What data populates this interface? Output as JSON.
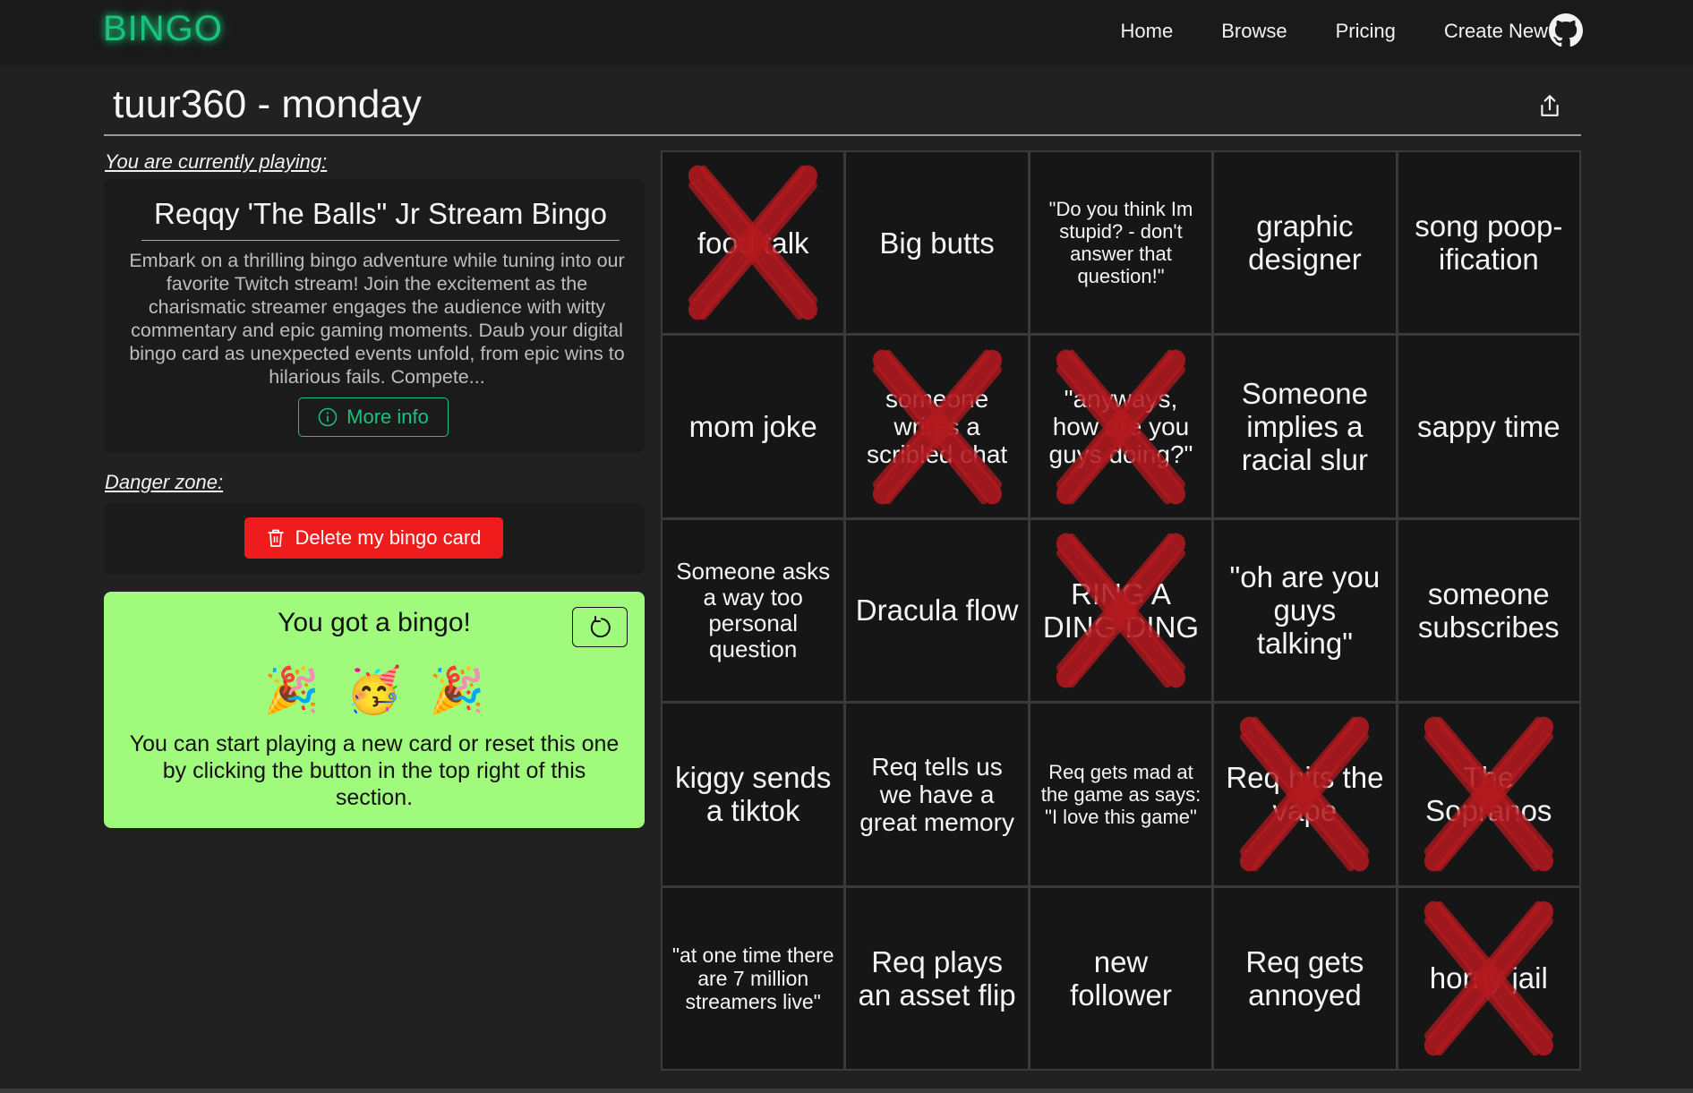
{
  "nav": {
    "logo": "BINGO",
    "links": [
      "Home",
      "Browse",
      "Pricing",
      "Create New"
    ],
    "github_icon": "github-icon"
  },
  "page": {
    "title": "tuur360 - monday",
    "share_icon": "share-icon"
  },
  "playing": {
    "label": "You are currently playing:",
    "game_title": "Reqqy 'The Balls\" Jr Stream Bingo",
    "description": "Embark on a thrilling bingo adventure while tuning into our favorite Twitch stream! Join the excitement as the charismatic streamer engages the audience with witty commentary and epic gaming moments. Daub your digital bingo card as unexpected events unfold, from epic wins to hilarious fails. Compete...",
    "more_info_label": "More info"
  },
  "danger": {
    "label": "Danger zone:",
    "delete_label": "Delete my bingo card"
  },
  "bingo_notice": {
    "title": "You got a bingo!",
    "emojis": [
      "🎉",
      "🥳",
      "🎉"
    ],
    "message": "You can start playing a new card or reset this one by clicking the button in the top right of this section."
  },
  "colors": {
    "accent": "#19c37d",
    "danger": "#ee1c1c",
    "bingo_bg": "#a0fa7c",
    "cross": "#b3191f"
  },
  "cells": [
    {
      "text": "food talk",
      "marked": true,
      "size": 33
    },
    {
      "text": "Big butts",
      "marked": false,
      "size": 33
    },
    {
      "text": "\"Do you think Im stupid? - don't answer that question!\"",
      "marked": false,
      "size": 22
    },
    {
      "text": "graphic designer",
      "marked": false,
      "size": 33
    },
    {
      "text": "song poop-ification",
      "marked": false,
      "size": 33
    },
    {
      "text": "mom joke",
      "marked": false,
      "size": 33
    },
    {
      "text": "someone writes a scribled chat",
      "marked": true,
      "size": 28
    },
    {
      "text": "\"anyways, how are you guys doing?\"",
      "marked": true,
      "size": 28
    },
    {
      "text": "Someone implies a racial slur",
      "marked": false,
      "size": 33
    },
    {
      "text": "sappy time",
      "marked": false,
      "size": 33
    },
    {
      "text": "Someone asks a way too personal question",
      "marked": false,
      "size": 26
    },
    {
      "text": "Dracula flow",
      "marked": false,
      "size": 33
    },
    {
      "text": "RING A DING DING",
      "marked": true,
      "size": 33
    },
    {
      "text": "\"oh are you guys talking\"",
      "marked": false,
      "size": 33
    },
    {
      "text": "someone subscribes",
      "marked": false,
      "size": 33
    },
    {
      "text": "kiggy sends a tiktok",
      "marked": false,
      "size": 33
    },
    {
      "text": "Req tells us we have a great memory",
      "marked": false,
      "size": 28
    },
    {
      "text": "Req gets mad at the game as says: \"I love this game\"",
      "marked": false,
      "size": 22
    },
    {
      "text": "Req hits the vape",
      "marked": true,
      "size": 33
    },
    {
      "text": "The Sopranos",
      "marked": true,
      "size": 33
    },
    {
      "text": "\"at one time there are 7 million streamers live\"",
      "marked": false,
      "size": 23
    },
    {
      "text": "Req plays an asset flip",
      "marked": false,
      "size": 33
    },
    {
      "text": "new follower",
      "marked": false,
      "size": 33
    },
    {
      "text": "Req gets annoyed",
      "marked": false,
      "size": 33
    },
    {
      "text": "horny jail",
      "marked": true,
      "size": 33
    }
  ]
}
